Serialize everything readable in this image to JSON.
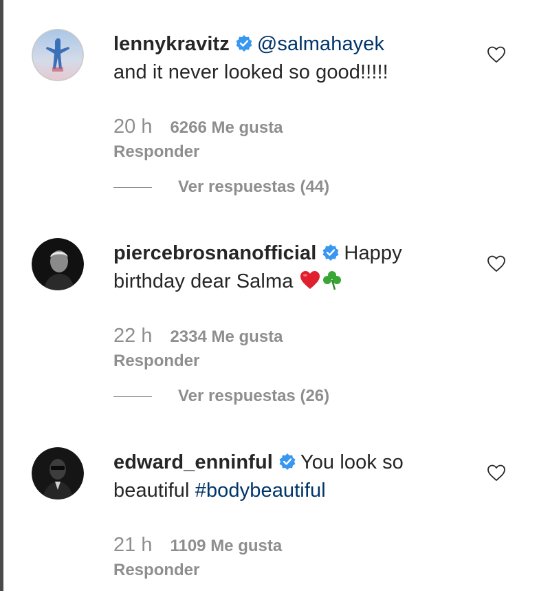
{
  "comments": [
    {
      "username": "lennykravitz",
      "mention": "@salmahayek",
      "text_line2": "and it never looked so good!!!!!",
      "time": "20 h",
      "likes": "6266 Me gusta",
      "reply_label": "Responder",
      "view_replies": "Ver respuestas (44)"
    },
    {
      "username": "piercebrosnanofficial",
      "text_line1_tail": "Happy",
      "text_line2": "birthday dear Salma",
      "time": "22 h",
      "likes": "2334 Me gusta",
      "reply_label": "Responder",
      "view_replies": "Ver respuestas (26)"
    },
    {
      "username": "edward_enninful",
      "text_line1_tail": "You look so",
      "text_line2_prefix": "beautiful",
      "hashtag": "#bodybeautiful",
      "time": "21 h",
      "likes": "1109 Me gusta",
      "reply_label": "Responder"
    }
  ],
  "icons": {
    "verified": "verified-badge-icon",
    "heart": "heart-outline-icon",
    "emoji_heart": "red-heart-emoji",
    "emoji_clover": "shamrock-emoji"
  },
  "colors": {
    "text": "#262626",
    "muted": "#8e8e8e",
    "link": "#003569",
    "verified": "#3897f0"
  }
}
